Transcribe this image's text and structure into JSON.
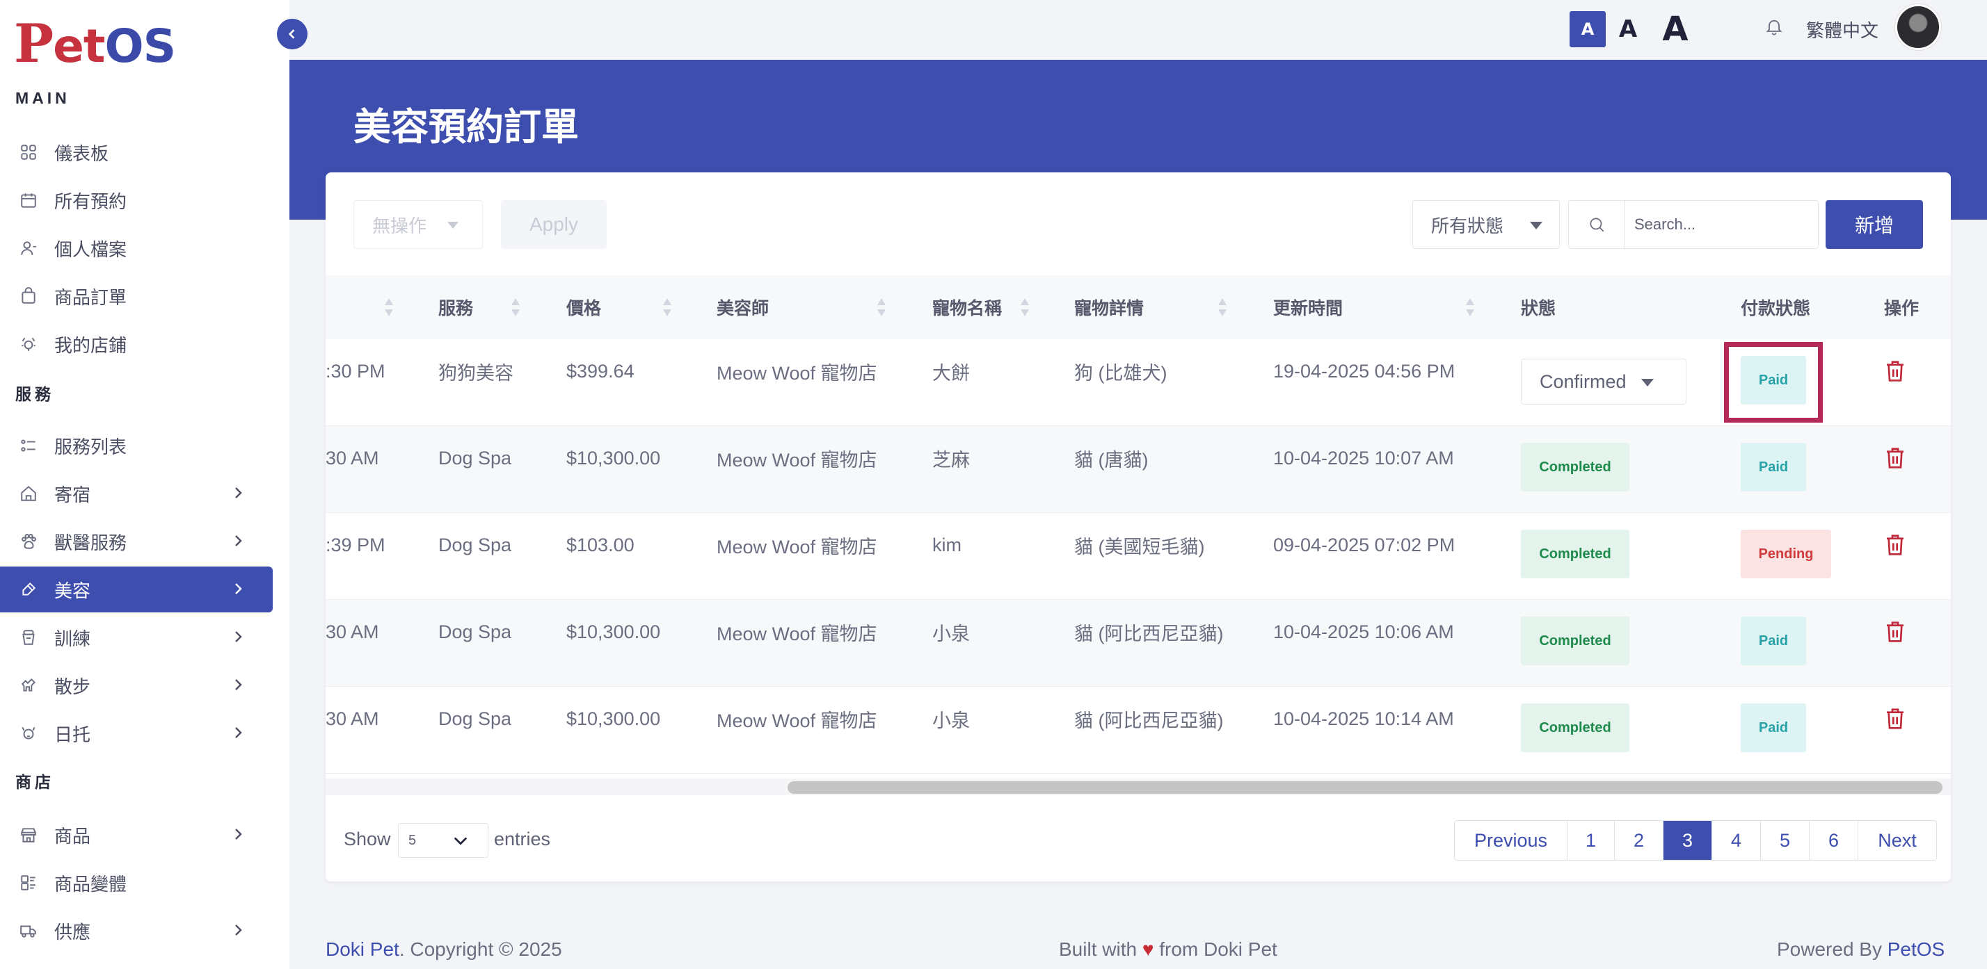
{
  "brand": {
    "logo_p": "P",
    "logo_et": "et",
    "logo_os": "OS"
  },
  "sidebar": {
    "sections": [
      {
        "title": "MAIN",
        "items": [
          {
            "label": "儀表板",
            "icon": "grid-icon"
          },
          {
            "label": "所有預約",
            "icon": "calendar-icon"
          },
          {
            "label": "個人檔案",
            "icon": "user-icon"
          },
          {
            "label": "商品訂單",
            "icon": "bag-icon"
          },
          {
            "label": "我的店鋪",
            "icon": "shop-icon"
          }
        ]
      },
      {
        "title": "服務",
        "items": [
          {
            "label": "服務列表",
            "icon": "list-icon"
          },
          {
            "label": "寄宿",
            "icon": "house-icon"
          },
          {
            "label": "獸醫服務",
            "icon": "paw-icon"
          },
          {
            "label": "美容",
            "icon": "brush-icon"
          },
          {
            "label": "訓練",
            "icon": "bowl-icon"
          },
          {
            "label": "散步",
            "icon": "walk-icon"
          },
          {
            "label": "日托",
            "icon": "pet-icon"
          }
        ]
      },
      {
        "title": "商店",
        "items": [
          {
            "label": "商品",
            "icon": "store-icon"
          },
          {
            "label": "商品變體",
            "icon": "variants-icon"
          },
          {
            "label": "供應",
            "icon": "truck-icon"
          }
        ]
      }
    ]
  },
  "topbar": {
    "font_small": "A",
    "font_medium": "A",
    "font_large": "A",
    "language": "繁體中文"
  },
  "page": {
    "title": "美容預約訂單"
  },
  "toolbar": {
    "bulk_action": "無操作",
    "apply": "Apply",
    "status_filter": "所有狀態",
    "search_placeholder": "Search...",
    "add": "新增"
  },
  "table": {
    "headers": {
      "service": "服務",
      "price": "價格",
      "groomer": "美容師",
      "pet_name": "寵物名稱",
      "pet_details": "寵物詳情",
      "updated": "更新時間",
      "status": "狀態",
      "payment": "付款狀態",
      "actions": "操作"
    },
    "rows": [
      {
        "time": ":30 PM",
        "service": "狗狗美容",
        "price": "$399.64",
        "groomer": "Meow Woof 寵物店",
        "pet_name": "大餅",
        "pet_details": "狗 (比雄犬)",
        "updated": "19-04-2025 04:56 PM",
        "status": "Confirmed",
        "payment": "Paid"
      },
      {
        "time": "30 AM",
        "service": "Dog Spa",
        "price": "$10,300.00",
        "groomer": "Meow Woof 寵物店",
        "pet_name": "芝麻",
        "pet_details": "貓 (唐貓)",
        "updated": "10-04-2025 10:07 AM",
        "status": "Completed",
        "payment": "Paid"
      },
      {
        "time": ":39 PM",
        "service": "Dog Spa",
        "price": "$103.00",
        "groomer": "Meow Woof 寵物店",
        "pet_name": "kim",
        "pet_details": "貓 (美國短毛貓)",
        "updated": "09-04-2025 07:02 PM",
        "status": "Completed",
        "payment": "Pending"
      },
      {
        "time": "30 AM",
        "service": "Dog Spa",
        "price": "$10,300.00",
        "groomer": "Meow Woof 寵物店",
        "pet_name": "小泉",
        "pet_details": "貓 (阿比西尼亞貓)",
        "updated": "10-04-2025 10:06 AM",
        "status": "Completed",
        "payment": "Paid"
      },
      {
        "time": "30 AM",
        "service": "Dog Spa",
        "price": "$10,300.00",
        "groomer": "Meow Woof 寵物店",
        "pet_name": "小泉",
        "pet_details": "貓 (阿比西尼亞貓)",
        "updated": "10-04-2025 10:14 AM",
        "status": "Completed",
        "payment": "Paid"
      }
    ]
  },
  "pagination": {
    "show_label": "Show",
    "page_size": "5",
    "entries_label": "entries",
    "previous": "Previous",
    "pages": [
      "1",
      "2",
      "3",
      "4",
      "5",
      "6"
    ],
    "current": "3",
    "next": "Next"
  },
  "footer": {
    "left_brand": "Doki Pet",
    "left_text": ". Copyright © 2025",
    "center_pre": "Built with ",
    "center_heart": "♥",
    "center_post": " from Doki Pet",
    "right_pre": "Powered By ",
    "right_brand": "PetOS"
  },
  "colors": {
    "primary": "#3e4eae",
    "highlight": "#b5295a",
    "logo_red": "#c7323f"
  }
}
